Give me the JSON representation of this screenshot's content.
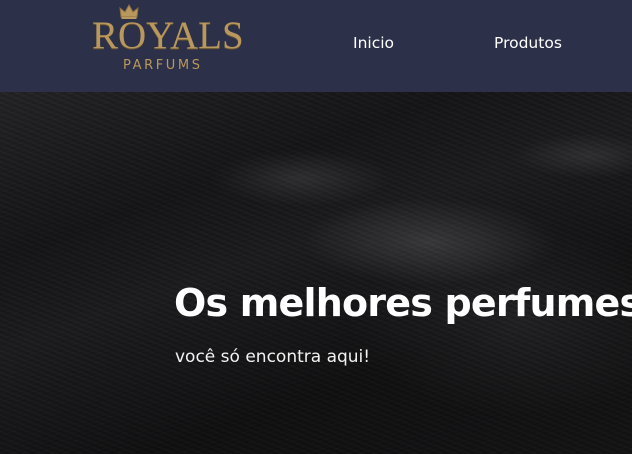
{
  "header": {
    "logo": {
      "crown_icon": "crown-icon",
      "brand_text": "ROYALS",
      "sub_text": "PARFUMS"
    },
    "nav": {
      "items": [
        {
          "label": "Inicio"
        },
        {
          "label": "Produtos"
        }
      ]
    }
  },
  "hero": {
    "headline": "Os melhores perfumes",
    "subheadline": "você só encontra aqui!"
  },
  "colors": {
    "header_background": "#2c3048",
    "logo_gold": "#b9985d",
    "hero_background": "#151517",
    "nav_text": "#ffffff",
    "hero_text": "#ffffff"
  }
}
